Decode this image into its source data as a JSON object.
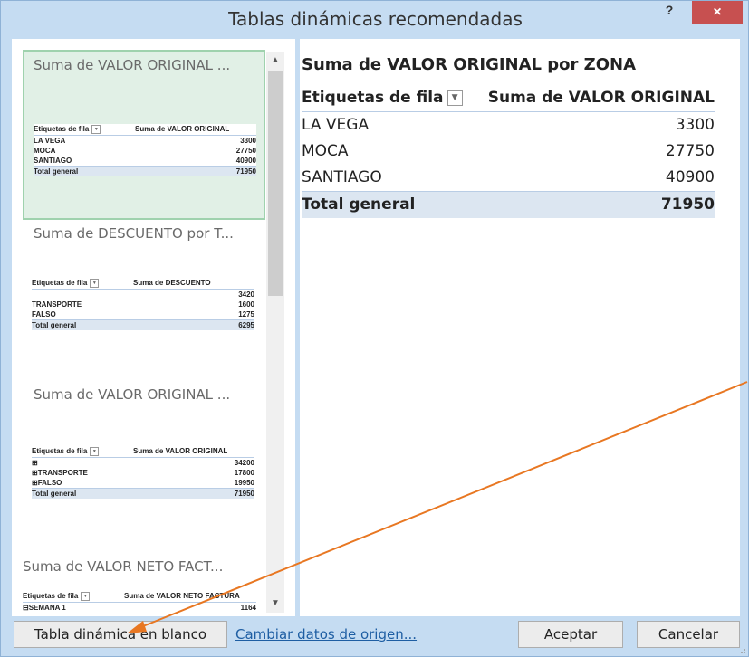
{
  "dialog": {
    "title": "Tablas dinámicas recomendadas",
    "help_label": "?",
    "close_label": "×"
  },
  "recommendations": [
    {
      "title": "Suma de VALOR ORIGINAL ...",
      "header": [
        "Etiquetas de fila",
        "Suma de VALOR ORIGINAL"
      ],
      "rows": [
        {
          "label": "LA VEGA",
          "value": "3300"
        },
        {
          "label": "MOCA",
          "value": "27750"
        },
        {
          "label": "SANTIAGO",
          "value": "40900"
        }
      ],
      "total": {
        "label": "Total general",
        "value": "71950"
      }
    },
    {
      "title": "Suma de DESCUENTO por T...",
      "header": [
        "Etiquetas de fila",
        "Suma de DESCUENTO"
      ],
      "rows": [
        {
          "label": "",
          "value": "3420"
        },
        {
          "label": "TRANSPORTE",
          "value": "1600"
        },
        {
          "label": "FALSO",
          "value": "1275"
        }
      ],
      "total": {
        "label": "Total general",
        "value": "6295"
      }
    },
    {
      "title": "Suma de VALOR ORIGINAL ...",
      "header": [
        "Etiquetas de fila",
        "Suma de VALOR ORIGINAL"
      ],
      "rows": [
        {
          "label": "⊞",
          "value": "34200"
        },
        {
          "label": "⊞TRANSPORTE",
          "value": "17800"
        },
        {
          "label": "⊞FALSO",
          "value": "19950"
        }
      ],
      "total": {
        "label": "Total general",
        "value": "71950"
      }
    },
    {
      "title": "Suma de VALOR NETO FACT...",
      "header": [
        "Etiquetas de fila",
        "Suma de VALOR NETO FACTURA"
      ],
      "rows": [
        {
          "label": "⊟SEMANA 1",
          "value": "1164"
        }
      ]
    }
  ],
  "preview": {
    "title": "Suma de VALOR ORIGINAL por ZONA",
    "header": [
      "Etiquetas de fila",
      "Suma de VALOR ORIGINAL"
    ],
    "rows": [
      {
        "label": "LA VEGA",
        "value": "3300"
      },
      {
        "label": "MOCA",
        "value": "27750"
      },
      {
        "label": "SANTIAGO",
        "value": "40900"
      }
    ],
    "total": {
      "label": "Total general",
      "value": "71950"
    }
  },
  "footer": {
    "blank_button": "Tabla dinámica en blanco",
    "change_source_link": "Cambiar datos de origen...",
    "ok_button": "Aceptar",
    "cancel_button": "Cancelar"
  },
  "colors": {
    "frame": "#c5dcf2",
    "selected_bg": "#e1f0e6",
    "total_row_bg": "#dce6f1",
    "close_button": "#c75050",
    "annotation_arrow": "#e87722"
  }
}
